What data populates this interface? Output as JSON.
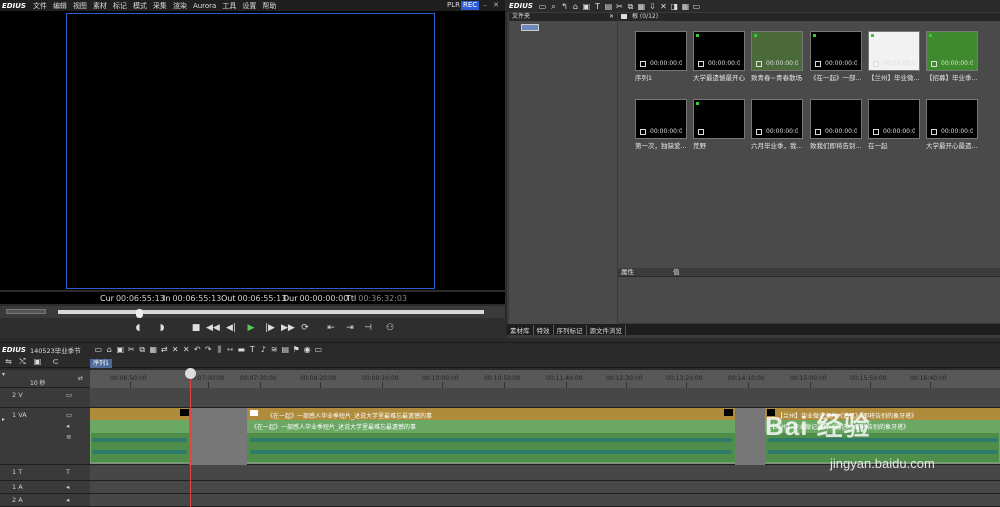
{
  "menubar": {
    "logo": "EDIUS",
    "items": [
      "文件",
      "编辑",
      "视图",
      "素材",
      "标记",
      "模式",
      "采集",
      "渲染",
      "Aurora",
      "工具",
      "设置",
      "帮助"
    ],
    "plr": "PLR",
    "rec": "REC"
  },
  "player": {
    "timecodes": [
      {
        "label": "Cur",
        "value": "00:06:55:13"
      },
      {
        "label": "In",
        "value": "00:06:55:13"
      },
      {
        "label": "Out",
        "value": "00:06:55:13"
      },
      {
        "label": "Dur",
        "value": "00:00:00:00"
      },
      {
        "label": "Ttl",
        "value": "00:36:32:03"
      }
    ]
  },
  "right_toolbar": {
    "logo": "EDIUS"
  },
  "folder_panel": {
    "title": "文件夹"
  },
  "bin": {
    "title": "根 (0/12)",
    "clips": [
      {
        "name": "序列1",
        "footer": "00:00:00:00",
        "dot": false,
        "fill": "#000"
      },
      {
        "name": "大学最遗憾最开心...",
        "footer": "00:00:00:00",
        "dot": true,
        "fill": "#000"
      },
      {
        "name": "致青春~青春散场...",
        "footer": "00:00:00:00",
        "dot": true,
        "fill": "#4a6a3a"
      },
      {
        "name": "《在一起》一部...",
        "footer": "00:00:00:00",
        "dot": true,
        "fill": "#000"
      },
      {
        "name": "【兰州】毕业微...",
        "footer": "00:00:00:00",
        "dot": true,
        "fill": "#f2f2f2"
      },
      {
        "name": "【招募】毕业季...",
        "footer": "00:00:00:00",
        "dot": true,
        "fill": "#3f8a2e"
      },
      {
        "name": "第一次，独缺爱...",
        "footer": "00:00:00:00",
        "dot": false,
        "fill": "#000"
      },
      {
        "name": "荒野",
        "footer": "",
        "dot": true,
        "fill": "#000"
      },
      {
        "name": "六月毕业季，我...",
        "footer": "00:00:00:00",
        "dot": false,
        "fill": "#000"
      },
      {
        "name": "致我们即将告别...",
        "footer": "00:00:00:00",
        "dot": false,
        "fill": "#000"
      },
      {
        "name": "在一起",
        "footer": "00:00:00:00",
        "dot": false,
        "fill": "#000"
      },
      {
        "name": "大学最开心最遗...",
        "footer": "00:00:00:00",
        "dot": false,
        "fill": "#000"
      }
    ]
  },
  "properties": {
    "col1": "属性",
    "col2": "值"
  },
  "right_tabs": [
    "素材库",
    "特效",
    "序列标记",
    "源文件浏览"
  ],
  "timeline": {
    "logo": "EDIUS",
    "project": "140523毕业季节",
    "seq_tab": "序列1",
    "zoom": "10 秒",
    "ruler_labels": [
      "00:06:50:00",
      "00:07:00:00",
      "00:07:30:00",
      "00:08:20:00",
      "00:09:10:00",
      "00:10:00:00",
      "00:10:50:00",
      "00:11:40:00",
      "00:12:30:00",
      "00:13:20:00",
      "00:14:10:00",
      "00:15:00:00",
      "00:15:50:00",
      "00:16:40:00"
    ],
    "tracks": [
      {
        "name": "2 V"
      },
      {
        "name": "1 VA"
      },
      {
        "name": "1 T"
      },
      {
        "name": "1 A"
      },
      {
        "name": "2 A"
      }
    ],
    "clips": [
      {
        "label": "《在一起》一部感人毕业季短片_述说大学里最难忘最遗憾的事"
      },
      {
        "label": "《在一起》一部感人毕业季短片_述说大学里最难忘最遗憾的事"
      },
      {
        "label": "【兰州】毕业微记录片《追忆》-即将告别的象牙塔》"
      },
      {
        "label": "【兰州】毕业微记录片《追忆》-即将告别的象牙塔》"
      }
    ]
  },
  "watermark": {
    "text": "Bai 经验",
    "url": "jingyan.baidu.com"
  }
}
